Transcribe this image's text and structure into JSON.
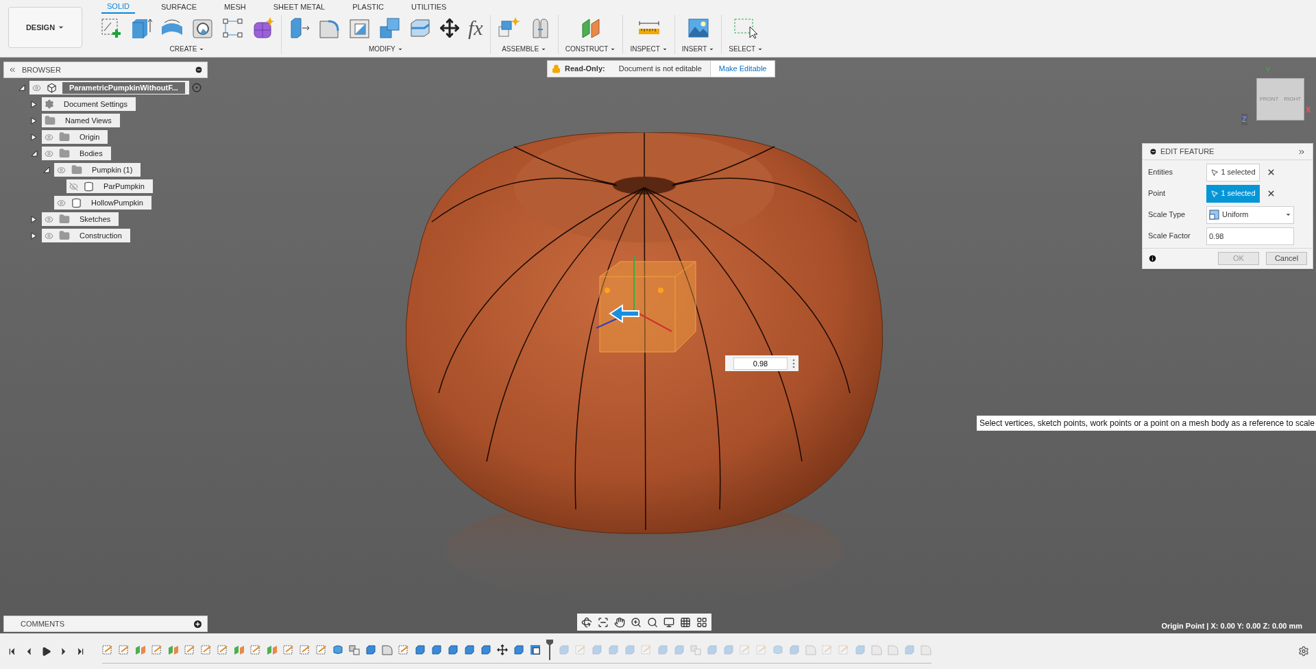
{
  "toolbar": {
    "workspace": "DESIGN",
    "tabs": [
      {
        "label": "SOLID",
        "selected": true
      },
      {
        "label": "SURFACE",
        "selected": false
      },
      {
        "label": "MESH",
        "selected": false
      },
      {
        "label": "SHEET METAL",
        "selected": false
      },
      {
        "label": "PLASTIC",
        "selected": false
      },
      {
        "label": "UTILITIES",
        "selected": false
      }
    ],
    "groups": [
      {
        "label": "CREATE",
        "tools": [
          {
            "kind": "sketch"
          },
          {
            "kind": "extrude"
          },
          {
            "kind": "revolve"
          },
          {
            "kind": "hole"
          },
          {
            "kind": "pattern"
          },
          {
            "kind": "form"
          }
        ]
      },
      {
        "label": "MODIFY",
        "tools": [
          {
            "kind": "presspull"
          },
          {
            "kind": "fillet"
          },
          {
            "kind": "shell"
          },
          {
            "kind": "combine"
          },
          {
            "kind": "offset"
          },
          {
            "kind": "move"
          },
          {
            "kind": "text",
            "text": "fx"
          }
        ]
      },
      {
        "label": "ASSEMBLE",
        "tools": [
          {
            "kind": "component"
          },
          {
            "kind": "joint"
          }
        ]
      },
      {
        "label": "CONSTRUCT",
        "tools": [
          {
            "kind": "plane"
          }
        ]
      },
      {
        "label": "INSPECT",
        "tools": [
          {
            "kind": "measure"
          }
        ]
      },
      {
        "label": "INSERT",
        "tools": [
          {
            "kind": "image"
          }
        ]
      },
      {
        "label": "SELECT",
        "tools": [
          {
            "kind": "select"
          }
        ]
      }
    ]
  },
  "browser": {
    "title": "BROWSER",
    "tree": [
      {
        "label": "ParametricPumpkinWithoutF...",
        "kind": "document",
        "expanded": true,
        "visible": true,
        "children": [
          {
            "label": "Document Settings",
            "kind": "settings",
            "expanded": false
          },
          {
            "label": "Named Views",
            "kind": "folder",
            "expanded": false
          },
          {
            "label": "Origin",
            "kind": "folder",
            "expanded": false,
            "visible": true
          },
          {
            "label": "Bodies",
            "kind": "folder",
            "expanded": true,
            "visible": true,
            "children": [
              {
                "label": "Pumpkin (1)",
                "kind": "folder",
                "expanded": true,
                "visible": true,
                "children": [
                  {
                    "label": "ParPumpkin",
                    "kind": "body",
                    "visible": false
                  }
                ]
              },
              {
                "label": "HollowPumpkin",
                "kind": "body",
                "visible": true
              }
            ]
          },
          {
            "label": "Sketches",
            "kind": "folder",
            "expanded": false,
            "visible": true
          },
          {
            "label": "Construction",
            "kind": "folder",
            "expanded": false,
            "visible": true
          }
        ]
      }
    ]
  },
  "readonly": {
    "label": "Read-Only:",
    "message": "Document is not editable",
    "action": "Make Editable"
  },
  "viewcube": {
    "faces": [
      "FRONT",
      "RIGHT"
    ],
    "axes": [
      "Y",
      "Z",
      "X"
    ]
  },
  "edit_feature": {
    "title": "EDIT FEATURE",
    "rows": [
      {
        "kind": "selection",
        "label": "Entities",
        "value": "1 selected",
        "selected": false
      },
      {
        "kind": "selection",
        "label": "Point",
        "value": "1 selected",
        "selected": true
      },
      {
        "kind": "dropdown",
        "label": "Scale Type",
        "value": "Uniform"
      },
      {
        "kind": "number",
        "label": "Scale Factor",
        "value": "0.98"
      }
    ],
    "buttons": [
      {
        "label": "OK",
        "disabled": true
      },
      {
        "label": "Cancel",
        "disabled": false
      }
    ]
  },
  "manipulator": {
    "value": "0.98"
  },
  "tooltip": "Select vertices, sketch points, work points or a point on a mesh body as a reference to scale",
  "comments": {
    "title": "COMMENTS"
  },
  "status": "Origin Point | X: 0.00 Y: 0.00 Z: 0.00 mm",
  "timeline": {
    "items": [
      {
        "kind": "sketch",
        "rolled_back": false
      },
      {
        "kind": "sketch",
        "rolled_back": false
      },
      {
        "kind": "plane",
        "rolled_back": false
      },
      {
        "kind": "sketch",
        "rolled_back": false
      },
      {
        "kind": "plane",
        "rolled_back": false
      },
      {
        "kind": "sketch",
        "rolled_back": false
      },
      {
        "kind": "sketch",
        "rolled_back": false
      },
      {
        "kind": "sketch",
        "rolled_back": false
      },
      {
        "kind": "plane",
        "rolled_back": false
      },
      {
        "kind": "sketch",
        "rolled_back": false
      },
      {
        "kind": "plane",
        "rolled_back": false
      },
      {
        "kind": "sketch",
        "rolled_back": false
      },
      {
        "kind": "sketch",
        "rolled_back": false
      },
      {
        "kind": "sketch",
        "rolled_back": false
      },
      {
        "kind": "form",
        "rolled_back": false
      },
      {
        "kind": "joint",
        "rolled_back": false
      },
      {
        "kind": "body",
        "rolled_back": false
      },
      {
        "kind": "fillet",
        "rolled_back": false
      },
      {
        "kind": "sketch",
        "rolled_back": false
      },
      {
        "kind": "body",
        "rolled_back": false
      },
      {
        "kind": "body",
        "rolled_back": false
      },
      {
        "kind": "body",
        "rolled_back": false
      },
      {
        "kind": "body",
        "rolled_back": false
      },
      {
        "kind": "body",
        "rolled_back": false
      },
      {
        "kind": "move",
        "rolled_back": false
      },
      {
        "kind": "body",
        "rolled_back": false
      },
      {
        "kind": "scale",
        "rolled_back": false
      },
      {
        "kind": "body",
        "rolled_back": true
      },
      {
        "kind": "sketch",
        "rolled_back": true
      },
      {
        "kind": "body",
        "rolled_back": true
      },
      {
        "kind": "body",
        "rolled_back": true
      },
      {
        "kind": "body",
        "rolled_back": true
      },
      {
        "kind": "sketch",
        "rolled_back": true
      },
      {
        "kind": "body",
        "rolled_back": true
      },
      {
        "kind": "body",
        "rolled_back": true
      },
      {
        "kind": "joint",
        "rolled_back": true
      },
      {
        "kind": "body",
        "rolled_back": true
      },
      {
        "kind": "body",
        "rolled_back": true
      },
      {
        "kind": "sketch",
        "rolled_back": true
      },
      {
        "kind": "sketch",
        "rolled_back": true
      },
      {
        "kind": "form",
        "rolled_back": true
      },
      {
        "kind": "body",
        "rolled_back": true
      },
      {
        "kind": "fillet",
        "rolled_back": true
      },
      {
        "kind": "sketch",
        "rolled_back": true
      },
      {
        "kind": "sketch",
        "rolled_back": true
      },
      {
        "kind": "body",
        "rolled_back": true
      },
      {
        "kind": "fillet",
        "rolled_back": true
      },
      {
        "kind": "fillet",
        "rolled_back": true
      },
      {
        "kind": "body",
        "rolled_back": true
      },
      {
        "kind": "fillet",
        "rolled_back": true
      }
    ]
  }
}
